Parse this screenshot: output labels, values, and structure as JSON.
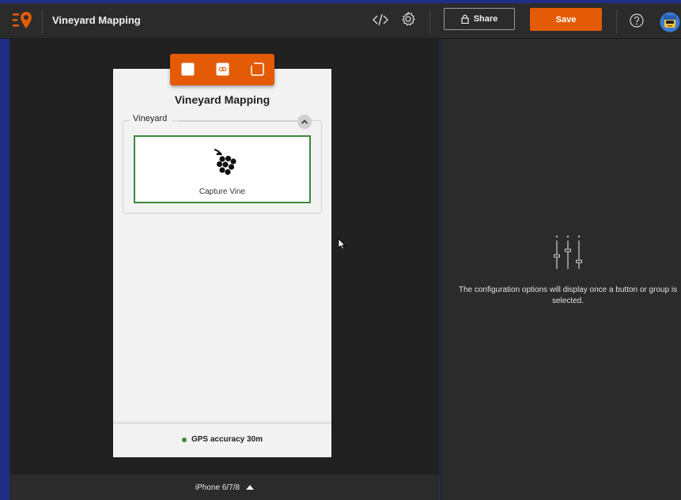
{
  "header": {
    "app_title": "Vineyard Mapping",
    "share_label": "Share",
    "save_label": "Save"
  },
  "icons": {
    "logo": "app-logo-icon",
    "code": "code-icon",
    "settings": "gear-icon",
    "share": "lock-icon",
    "help": "help-icon",
    "avatar": "user-avatar"
  },
  "preview": {
    "title": "Vineyard Mapping",
    "group": {
      "label": "Vineyard",
      "buttons": [
        {
          "label": "Capture Vine",
          "icon": "grape-icon"
        }
      ]
    },
    "footer_status": "GPS accuracy 30m",
    "status_color": "#3c8a3c",
    "toolbar_icons": [
      "square-icon",
      "link-icon",
      "frame-icon"
    ]
  },
  "device": {
    "selected": "iPhone 6/7/8"
  },
  "config_panel": {
    "message": "The configuration options will display once a button or group is selected."
  },
  "colors": {
    "accent": "#e35b06",
    "selection": "#3c8a3c",
    "background_dark": "#212121"
  }
}
